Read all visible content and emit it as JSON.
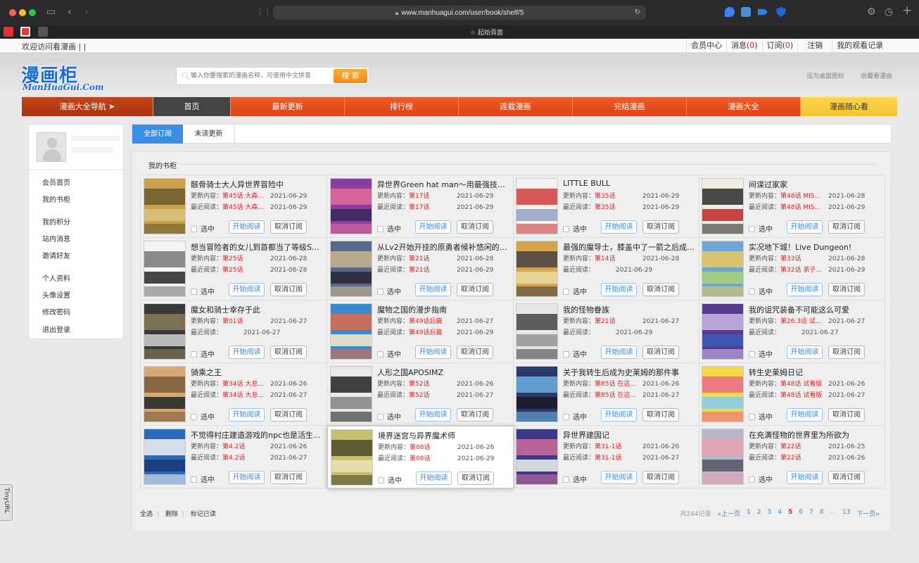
{
  "browser": {
    "url": "www.manhuagui.com/user/book/shelf/5",
    "start_page": "起始頁面"
  },
  "topbar": {
    "welcome": "欢迎访问看漫画 | |",
    "links": [
      {
        "label": "会员中心",
        "count": ""
      },
      {
        "label": "消息",
        "count": "0"
      },
      {
        "label": "订阅",
        "count": "0"
      },
      {
        "label": "注销",
        "count": ""
      },
      {
        "label": "我的观看记录",
        "count": ""
      }
    ]
  },
  "header": {
    "logo_cn": "漫画柜",
    "logo_en": "ManHuaGui.Com",
    "search_placeholder": "输入你要搜索的漫画名称，可使用中文拼音",
    "search_button": "搜 索",
    "set_desktop": "设为桌面图标",
    "favorite": "收藏看漫画"
  },
  "nav": [
    "漫画大全导航 ➤",
    "首页",
    "最新更新",
    "排行榜",
    "连载漫画",
    "完结漫画",
    "漫画大全",
    "漫画随心看"
  ],
  "sidebar": {
    "items": [
      "会员首页",
      "我的书柜",
      "我的积分",
      "站内消息",
      "邀请好友",
      "个人资料",
      "头像设置",
      "修改密码",
      "退出登录"
    ]
  },
  "tabs": [
    "全部订阅",
    "未读更新"
  ],
  "shelf": {
    "title": "我的书柜",
    "update_label": "更新内容：",
    "read_label": "最近阅读：",
    "select_label": "选中",
    "read_button": "开始阅读",
    "unsub_button": "取消订阅",
    "books": [
      {
        "title": "骸骨骑士大人异世界冒险中",
        "upd_ep": "第45话 大森...",
        "upd_date": "2021-06-29",
        "read_ep": "第45话 大森...",
        "read_date": "2021-06-29"
      },
      {
        "title": "异世界Green hat man～用最强技能...",
        "upd_ep": "第17话",
        "upd_date": "2021-06-29",
        "read_ep": "第17话",
        "read_date": "2021-06-29"
      },
      {
        "title": "LITTLE BULL",
        "upd_ep": "第35话",
        "upd_date": "2021-06-29",
        "read_ep": "第35话",
        "read_date": "2021-06-29"
      },
      {
        "title": "间谍过家家",
        "upd_ep": "第48话 MISS...",
        "upd_date": "2021-06-28",
        "read_ep": "第48话 MISS...",
        "read_date": "2021-06-29"
      },
      {
        "title": "想当冒险者的女儿到首都当了等级S...",
        "upd_ep": "第25话",
        "upd_date": "2021-06-28",
        "read_ep": "第25话",
        "read_date": "2021-06-28"
      },
      {
        "title": "从Lv2开始开挂的原勇者候补悠闲的异...",
        "upd_ep": "第21话",
        "upd_date": "2021-06-28",
        "read_ep": "第21话",
        "read_date": "2021-06-29"
      },
      {
        "title": "最强的魔导士，膝盖中了一箭之后成...",
        "upd_ep": "第14话",
        "upd_date": "2021-06-28",
        "read_ep": "",
        "read_date": "2021-06-29"
      },
      {
        "title": "实况地下城！Live Dungeon!",
        "upd_ep": "第33话",
        "upd_date": "2021-06-28",
        "read_ep": "第32话 弟子...",
        "read_date": "2021-06-29"
      },
      {
        "title": "魔女和骑士幸存于此",
        "upd_ep": "第01话",
        "upd_date": "2021-06-27",
        "read_ep": "",
        "read_date": "2021-06-27"
      },
      {
        "title": "魔物之国的漫步指南",
        "upd_ep": "第49话后篇",
        "upd_date": "2021-06-27",
        "read_ep": "第49话后篇",
        "read_date": "2021-06-29"
      },
      {
        "title": "我的怪物眷族",
        "upd_ep": "第21话",
        "upd_date": "2021-06-27",
        "read_ep": "",
        "read_date": "2021-06-29"
      },
      {
        "title": "我的诅咒装备不可能这么可爱",
        "upd_ep": "第26.3话 试...",
        "upd_date": "2021-06-27",
        "read_ep": "",
        "read_date": "2021-06-27"
      },
      {
        "title": "骑乘之王",
        "upd_ep": "第34话 大总...",
        "upd_date": "2021-06-26",
        "read_ep": "第34话 大总...",
        "read_date": "2021-06-27"
      },
      {
        "title": "人形之国APOSIMZ",
        "upd_ep": "第52话",
        "upd_date": "2021-06-26",
        "read_ep": "第52话",
        "read_date": "2021-06-27"
      },
      {
        "title": "关于我转生后成为史莱姆的那件事",
        "upd_ep": "第85话 在这...",
        "upd_date": "2021-06-26",
        "read_ep": "第85话 在这...",
        "read_date": "2021-06-27"
      },
      {
        "title": "转生史莱姆日记",
        "upd_ep": "第48话 试看版",
        "upd_date": "2021-06-26",
        "read_ep": "第48话 试看版",
        "read_date": "2021-06-27"
      },
      {
        "title": "不觉得村庄建造游戏的npc也是活生...",
        "upd_ep": "第4.2话",
        "upd_date": "2021-06-26",
        "read_ep": "第4.2话",
        "read_date": "2021-06-27"
      },
      {
        "title": "境界迷宫与异界魔术师",
        "upd_ep": "第08话",
        "upd_date": "2021-06-26",
        "read_ep": "第08话",
        "read_date": "2021-06-29"
      },
      {
        "title": "异世界建国记",
        "upd_ep": "第31-1话",
        "upd_date": "2021-06-26",
        "read_ep": "第31-1话",
        "read_date": "2021-06-27"
      },
      {
        "title": "在充满怪物的世界里为所欲为",
        "upd_ep": "第22话",
        "upd_date": "2021-06-25",
        "read_ep": "第22话",
        "read_date": "2021-06-26"
      }
    ]
  },
  "actions": {
    "select_all": "全选",
    "delete": "删除",
    "mark_read": "标记已读"
  },
  "pager": {
    "records": "共244记录",
    "prev": "«上一页",
    "pages": [
      "1",
      "2",
      "3",
      "4",
      "5",
      "6",
      "7",
      "8"
    ],
    "current": "5",
    "dots": "...",
    "last": "13",
    "next": "下一页»"
  },
  "tinyurl": "TinyURL",
  "colors": {
    "accent": "#3a8ee6",
    "nav_orange": "#f05a28",
    "nav_yellow": "#f4c430",
    "episode_red": "#dd2222"
  }
}
